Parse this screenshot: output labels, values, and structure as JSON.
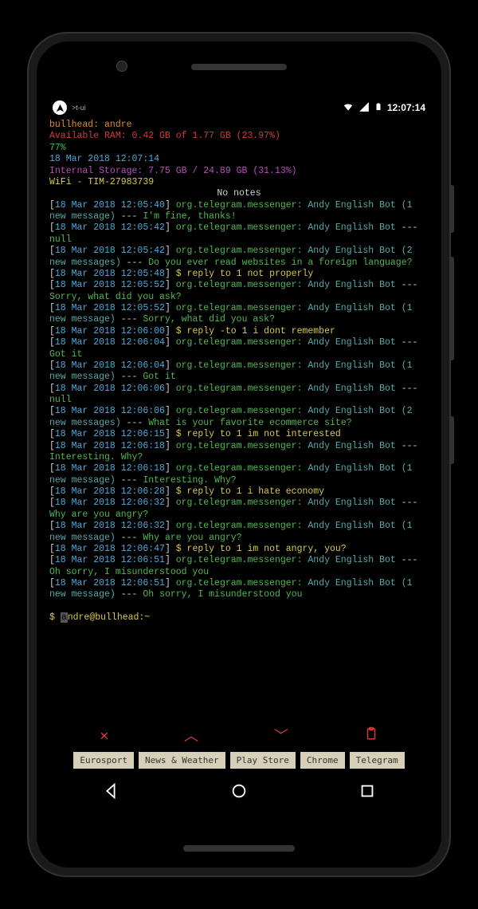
{
  "status_bar": {
    "app_label": ">t-ui",
    "time": "12:07:14"
  },
  "header": {
    "host": "bullhead: andre",
    "ram": "Available RAM: 0.42 GB of 1.77 GB (23.97%)",
    "battery": "77%",
    "clock": "18 Mar 2018 12:07:14",
    "storage": "Internal Storage: 7.75 GB / 24.89 GB (31.13%)",
    "wifi": "WiFi - TIM-27983739",
    "notes": "No notes"
  },
  "log": [
    {
      "ts": "18 Mar 2018 12:05:40",
      "pkg": "org.telegram.messenger:",
      "from": "Andy English Bot (1 new message)",
      "sep": "---",
      "msg": "I'm fine, thanks!"
    },
    {
      "ts": "18 Mar 2018 12:05:42",
      "pkg": "org.telegram.messenger:",
      "from": "Andy English Bot",
      "sep": "---",
      "msg": "null"
    },
    {
      "ts": "18 Mar 2018 12:05:42",
      "pkg": "org.telegram.messenger:",
      "from": "Andy English Bot (2 new messages)",
      "sep": "---",
      "msg": "Do you ever read websites in a foreign language?"
    },
    {
      "ts": "18 Mar 2018 12:05:48",
      "cmd": "$ reply to 1 not properly"
    },
    {
      "ts": "18 Mar 2018 12:05:52",
      "pkg": "org.telegram.messenger:",
      "from": "Andy English Bot",
      "sep": "---",
      "msg": "Sorry, what did you ask?"
    },
    {
      "ts": "18 Mar 2018 12:05:52",
      "pkg": "org.telegram.messenger:",
      "from": "Andy English Bot (1 new message)",
      "sep": "---",
      "msg": "Sorry, what did you ask?"
    },
    {
      "ts": "18 Mar 2018 12:06:00",
      "cmd": "$ reply -to 1 i dont remember"
    },
    {
      "ts": "18 Mar 2018 12:06:04",
      "pkg": "org.telegram.messenger:",
      "from": "Andy English Bot",
      "sep": "---",
      "msg": "Got it"
    },
    {
      "ts": "18 Mar 2018 12:06:04",
      "pkg": "org.telegram.messenger:",
      "from": "Andy English Bot (1 new message)",
      "sep": "---",
      "msg": "Got it"
    },
    {
      "ts": "18 Mar 2018 12:06:06",
      "pkg": "org.telegram.messenger:",
      "from": "Andy English Bot",
      "sep": "---",
      "msg": "null"
    },
    {
      "ts": "18 Mar 2018 12:06:06",
      "pkg": "org.telegram.messenger:",
      "from": "Andy English Bot (2 new messages)",
      "sep": "---",
      "msg": "What is your favorite ecommerce site?"
    },
    {
      "ts": "18 Mar 2018 12:06:15",
      "cmd": "$ reply to 1 im not interested"
    },
    {
      "ts": "18 Mar 2018 12:06:18",
      "pkg": "org.telegram.messenger:",
      "from": "Andy English Bot",
      "sep": "---",
      "msg": "Interesting. Why?"
    },
    {
      "ts": "18 Mar 2018 12:06:18",
      "pkg": "org.telegram.messenger:",
      "from": "Andy English Bot (1 new message)",
      "sep": "---",
      "msg": "Interesting. Why?"
    },
    {
      "ts": "18 Mar 2018 12:06:28",
      "cmd": "$ reply to 1 i hate economy"
    },
    {
      "ts": "18 Mar 2018 12:06:32",
      "pkg": "org.telegram.messenger:",
      "from": "Andy English Bot",
      "sep": "---",
      "msg": "Why are you angry?"
    },
    {
      "ts": "18 Mar 2018 12:06:32",
      "pkg": "org.telegram.messenger:",
      "from": "Andy English Bot (1 new message)",
      "sep": "---",
      "msg": "Why are you angry?"
    },
    {
      "ts": "18 Mar 2018 12:06:47",
      "cmd": "$ reply to 1 im not angry, you?"
    },
    {
      "ts": "18 Mar 2018 12:06:51",
      "pkg": "org.telegram.messenger:",
      "from": "Andy English Bot",
      "sep": "---",
      "msg": "Oh sorry, I misunderstood you"
    },
    {
      "ts": "18 Mar 2018 12:06:51",
      "pkg": "org.telegram.messenger:",
      "from": "Andy English Bot (1 new message)",
      "sep": "---",
      "msg": "Oh sorry, I misunderstood you"
    }
  ],
  "prompt": {
    "symbol": "$",
    "text": "ndre@bullhead:~",
    "cursor_char": "a"
  },
  "apps": [
    "Eurosport",
    "News & Weather",
    "Play Store",
    "Chrome",
    "Telegram"
  ]
}
